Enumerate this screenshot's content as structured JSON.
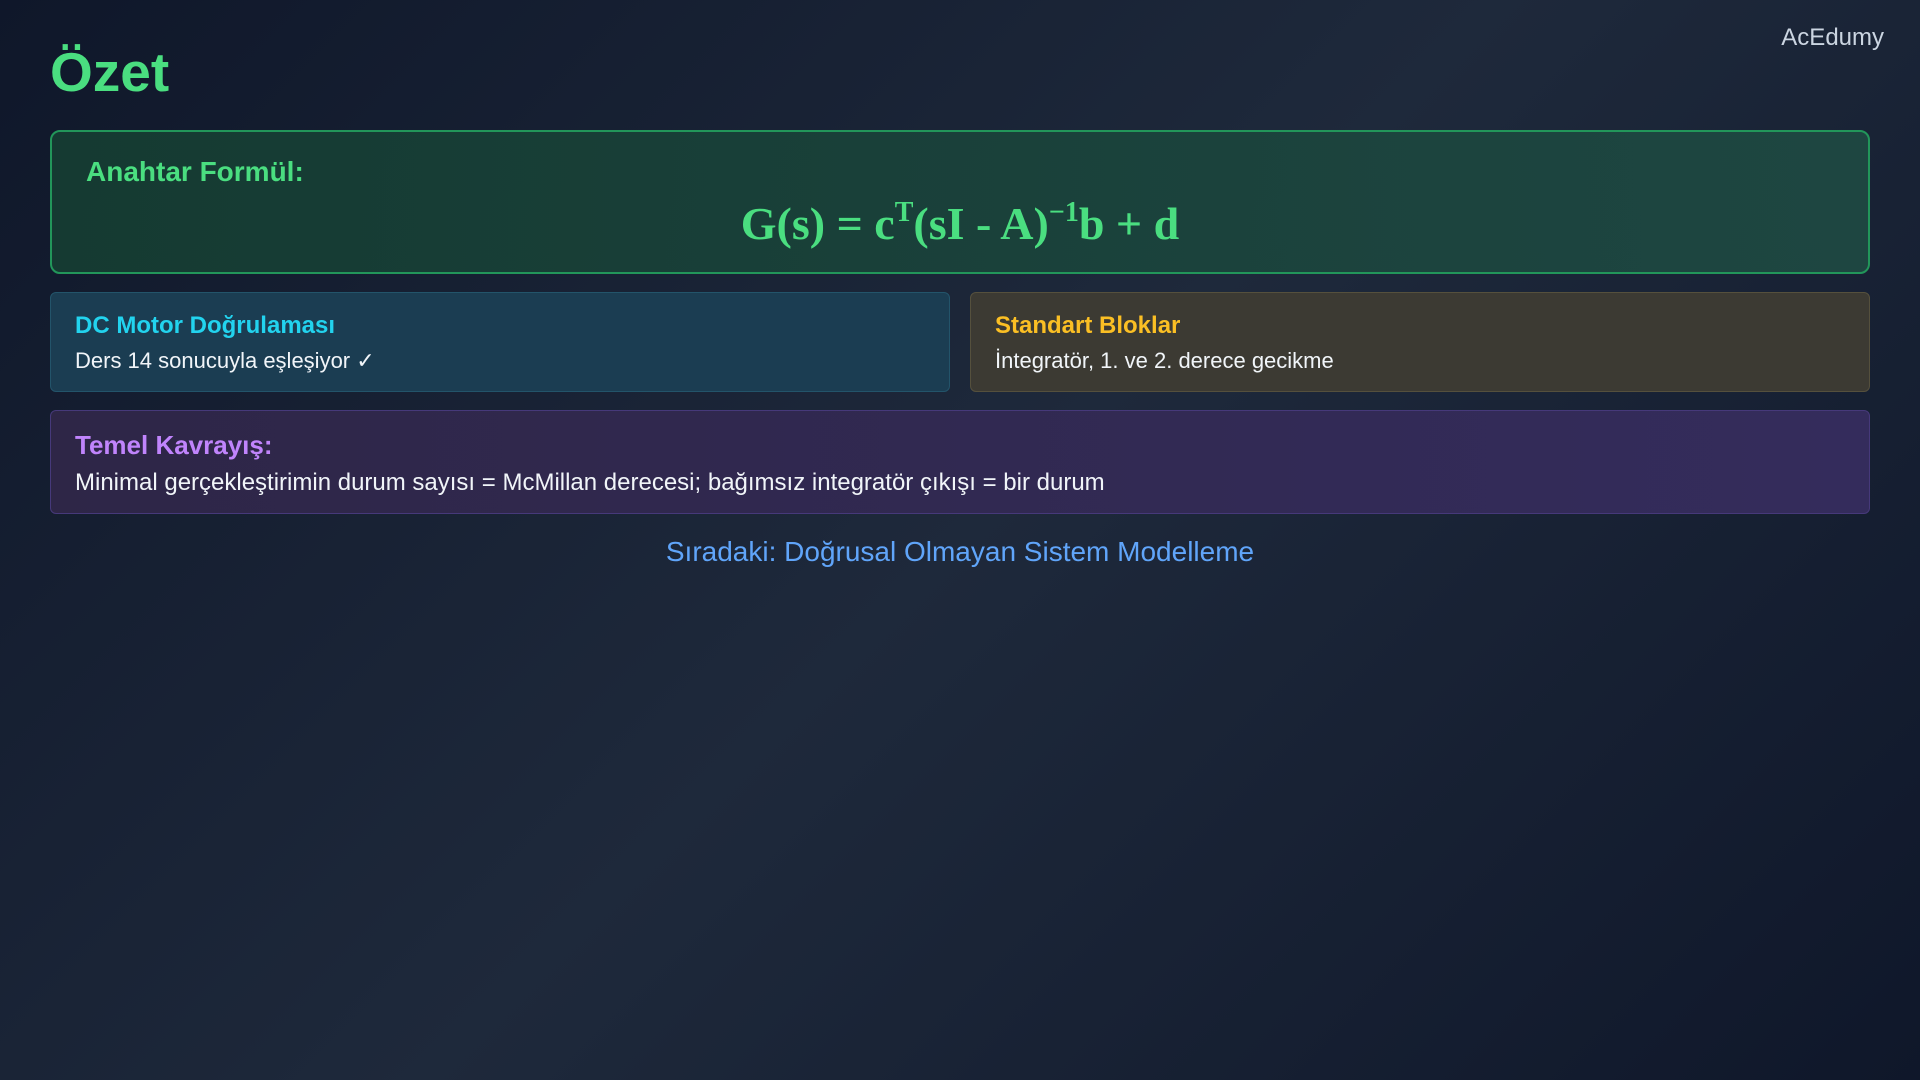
{
  "brand": "AcEdumy",
  "title": "Özet",
  "formula_card": {
    "label": "Anahtar Formül:",
    "formula": {
      "part1": "G(s) = c",
      "sup1": "T",
      "part2": "(sI - A)",
      "sup2": "−1",
      "part3": "b + d"
    }
  },
  "cards": [
    {
      "title": "DC Motor Doğrulaması",
      "text": "Ders 14 sonucuyla eşleşiyor ✓",
      "color": "#22d3ee"
    },
    {
      "title": "Standart Bloklar",
      "text": "İntegratör, 1. ve 2. derece gecikme",
      "color": "#fbbf24"
    }
  ],
  "insight": {
    "title": "Temel Kavrayış:",
    "text": "Minimal gerçekleştirimin durum sayısı = McMillan derecesi; bağımsız integratör çıkışı = bir durum",
    "color": "#c084fc"
  },
  "next": "Sıradaki: Doğrusal Olmayan Sistem Modelleme",
  "colors": {
    "accent_green": "#4ade80",
    "link_blue": "#60a5fa"
  }
}
